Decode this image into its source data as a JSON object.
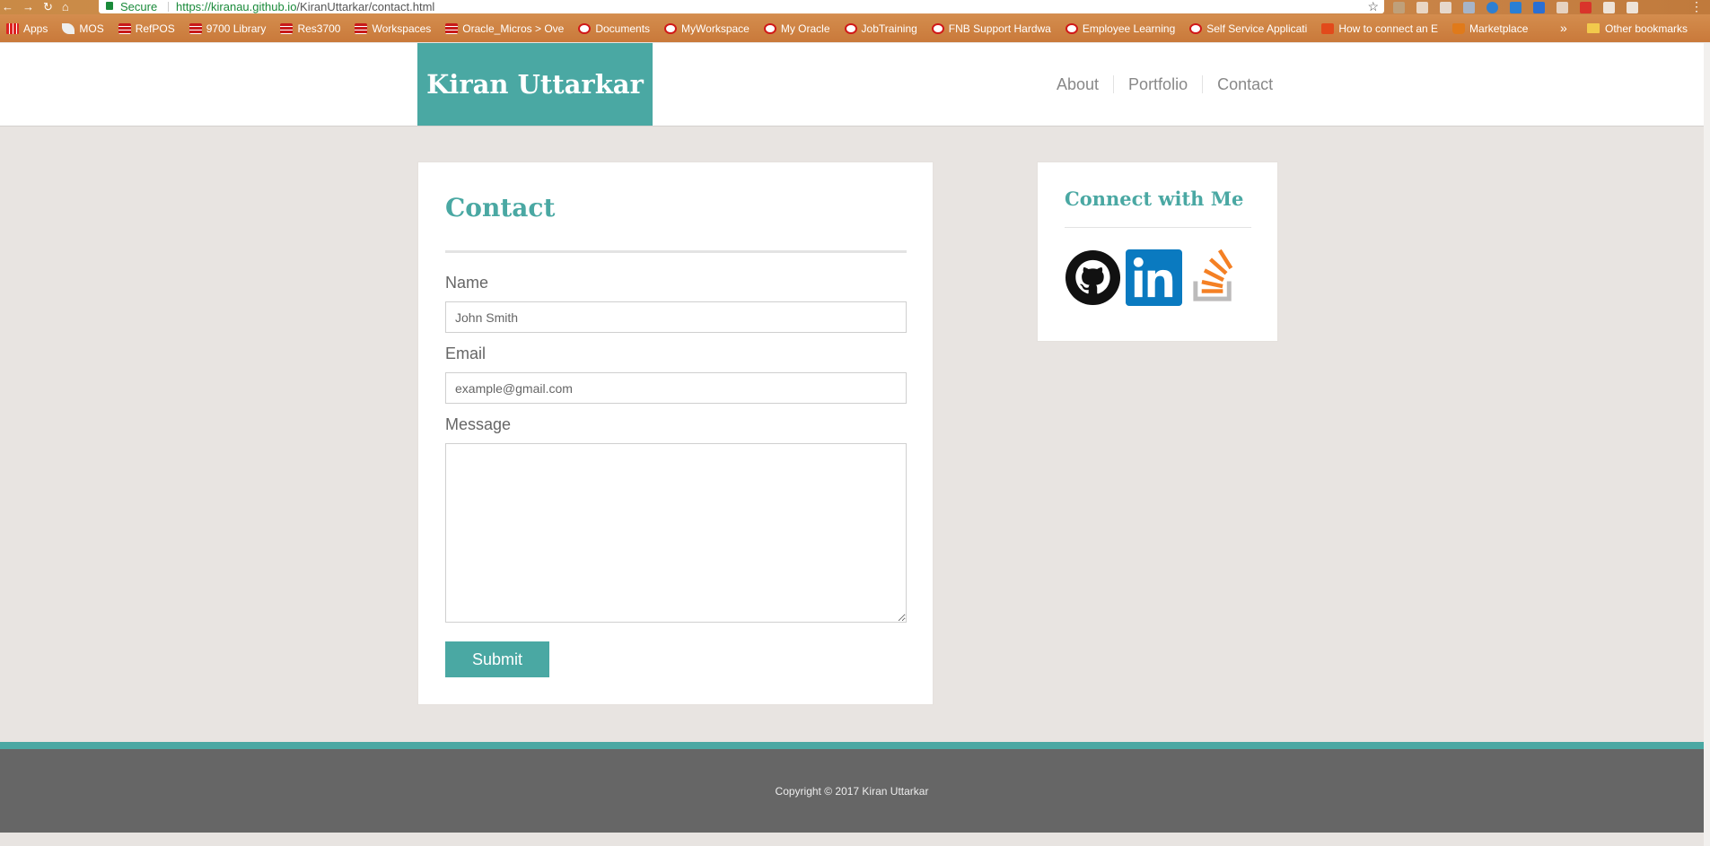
{
  "browser": {
    "secure_label": "Secure",
    "url_host": "https://kiranau.github.io",
    "url_path": "/KiranUttarkar/contact.html",
    "bookmarks": [
      {
        "label": "Apps",
        "icon": "apps-grid-icon"
      },
      {
        "label": "MOS",
        "icon": "mos-icon"
      },
      {
        "label": "RefPOS",
        "icon": "oracle-stack-icon"
      },
      {
        "label": "9700 Library",
        "icon": "oracle-stack-icon"
      },
      {
        "label": "Res3700",
        "icon": "oracle-stack-icon"
      },
      {
        "label": "Workspaces",
        "icon": "oracle-stack-icon"
      },
      {
        "label": "Oracle_Micros > Ove",
        "icon": "oracle-stack-icon"
      },
      {
        "label": "Documents",
        "icon": "oracle-o-icon"
      },
      {
        "label": "MyWorkspace",
        "icon": "oracle-o-icon"
      },
      {
        "label": "My Oracle",
        "icon": "oracle-o-icon"
      },
      {
        "label": "JobTraining",
        "icon": "oracle-o-icon"
      },
      {
        "label": "FNB Support Hardwa",
        "icon": "oracle-o-icon"
      },
      {
        "label": "Employee Learning",
        "icon": "oracle-o-icon"
      },
      {
        "label": "Self Service Applicati",
        "icon": "oracle-o-icon"
      },
      {
        "label": "How to connect an E",
        "icon": "magento-icon"
      },
      {
        "label": "Marketplace",
        "icon": "marketplace-icon"
      }
    ],
    "more_label": "»",
    "other_bookmarks": "Other bookmarks"
  },
  "site": {
    "brand": "Kiran Uttarkar",
    "nav": [
      "About",
      "Portfolio",
      "Contact"
    ],
    "accent": "#4aa8a3"
  },
  "contact": {
    "title": "Contact",
    "name_label": "Name",
    "name_placeholder": "John Smith",
    "email_label": "Email",
    "email_placeholder": "example@gmail.com",
    "message_label": "Message",
    "submit_label": "Submit"
  },
  "social": {
    "title": "Connect with Me",
    "icons": [
      "github-icon",
      "linkedin-icon",
      "stackoverflow-icon"
    ]
  },
  "footer": {
    "copyright": "Copyright © 2017 Kiran Uttarkar"
  }
}
